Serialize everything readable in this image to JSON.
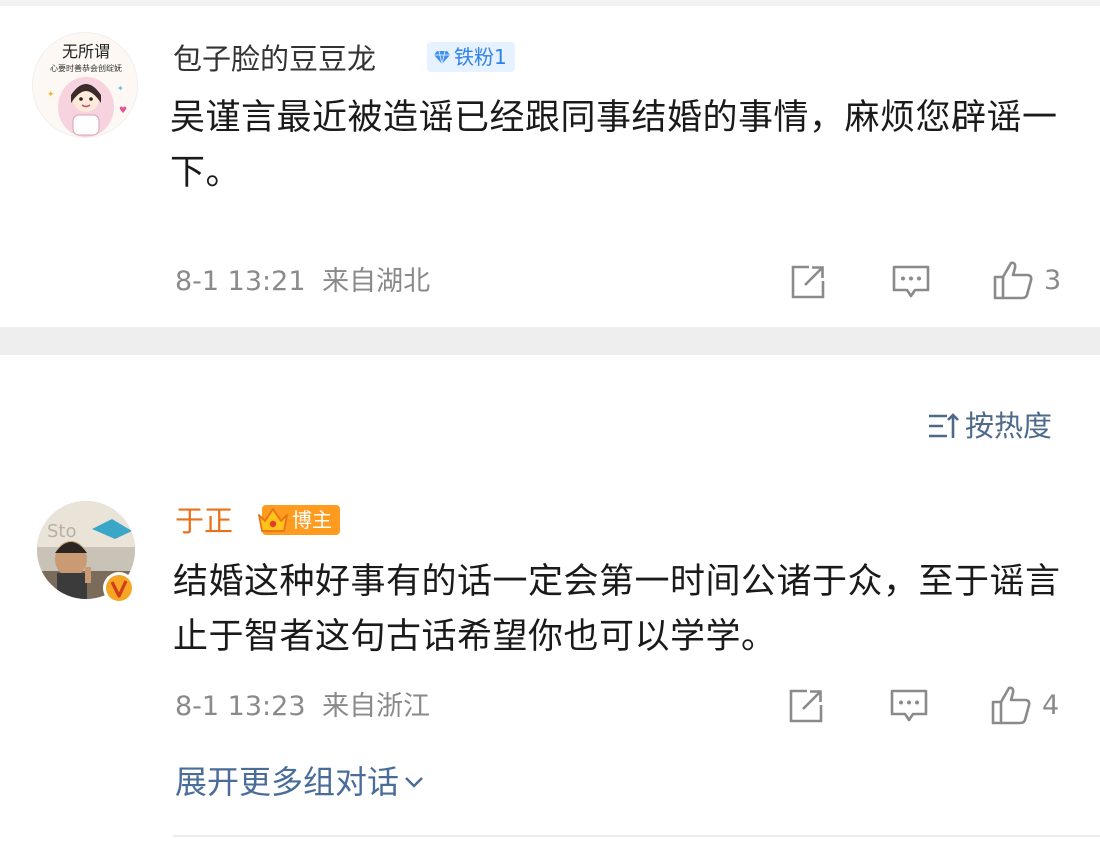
{
  "comment1": {
    "username": "包子脸的豆豆龙",
    "badge": "铁粉1",
    "text": "吴谨言最近被造谣已经跟同事结婚的事情，麻烦您辟谣一下。",
    "time": "8-1 13:21",
    "location": "来自湖北",
    "likes": "3",
    "avatar_text": [
      "无所谓",
      "心要时善恭会创绽妩"
    ]
  },
  "sort_label": "按热度",
  "comment2": {
    "username": "于正",
    "badge": "博主",
    "text": "结婚这种好事有的话一定会第一时间公诸于众，至于谣言止于智者这句古话希望你也可以学学。",
    "time": "8-1 13:23",
    "location": "来自浙江",
    "likes": "4"
  },
  "expand_label": "展开更多组对话",
  "colors": {
    "blogger_name": "#e8721b",
    "link": "#496d98",
    "fan_badge_bg": "#e6f2ff",
    "fan_badge_fg": "#2f82ea",
    "blogger_badge": "#ff9b1e",
    "verified": "#f6a623"
  },
  "icons": [
    "share-icon",
    "comment-icon",
    "like-icon",
    "sort-icon",
    "chevron-down-icon",
    "diamond-icon",
    "crown-icon",
    "verified-badge-icon"
  ]
}
